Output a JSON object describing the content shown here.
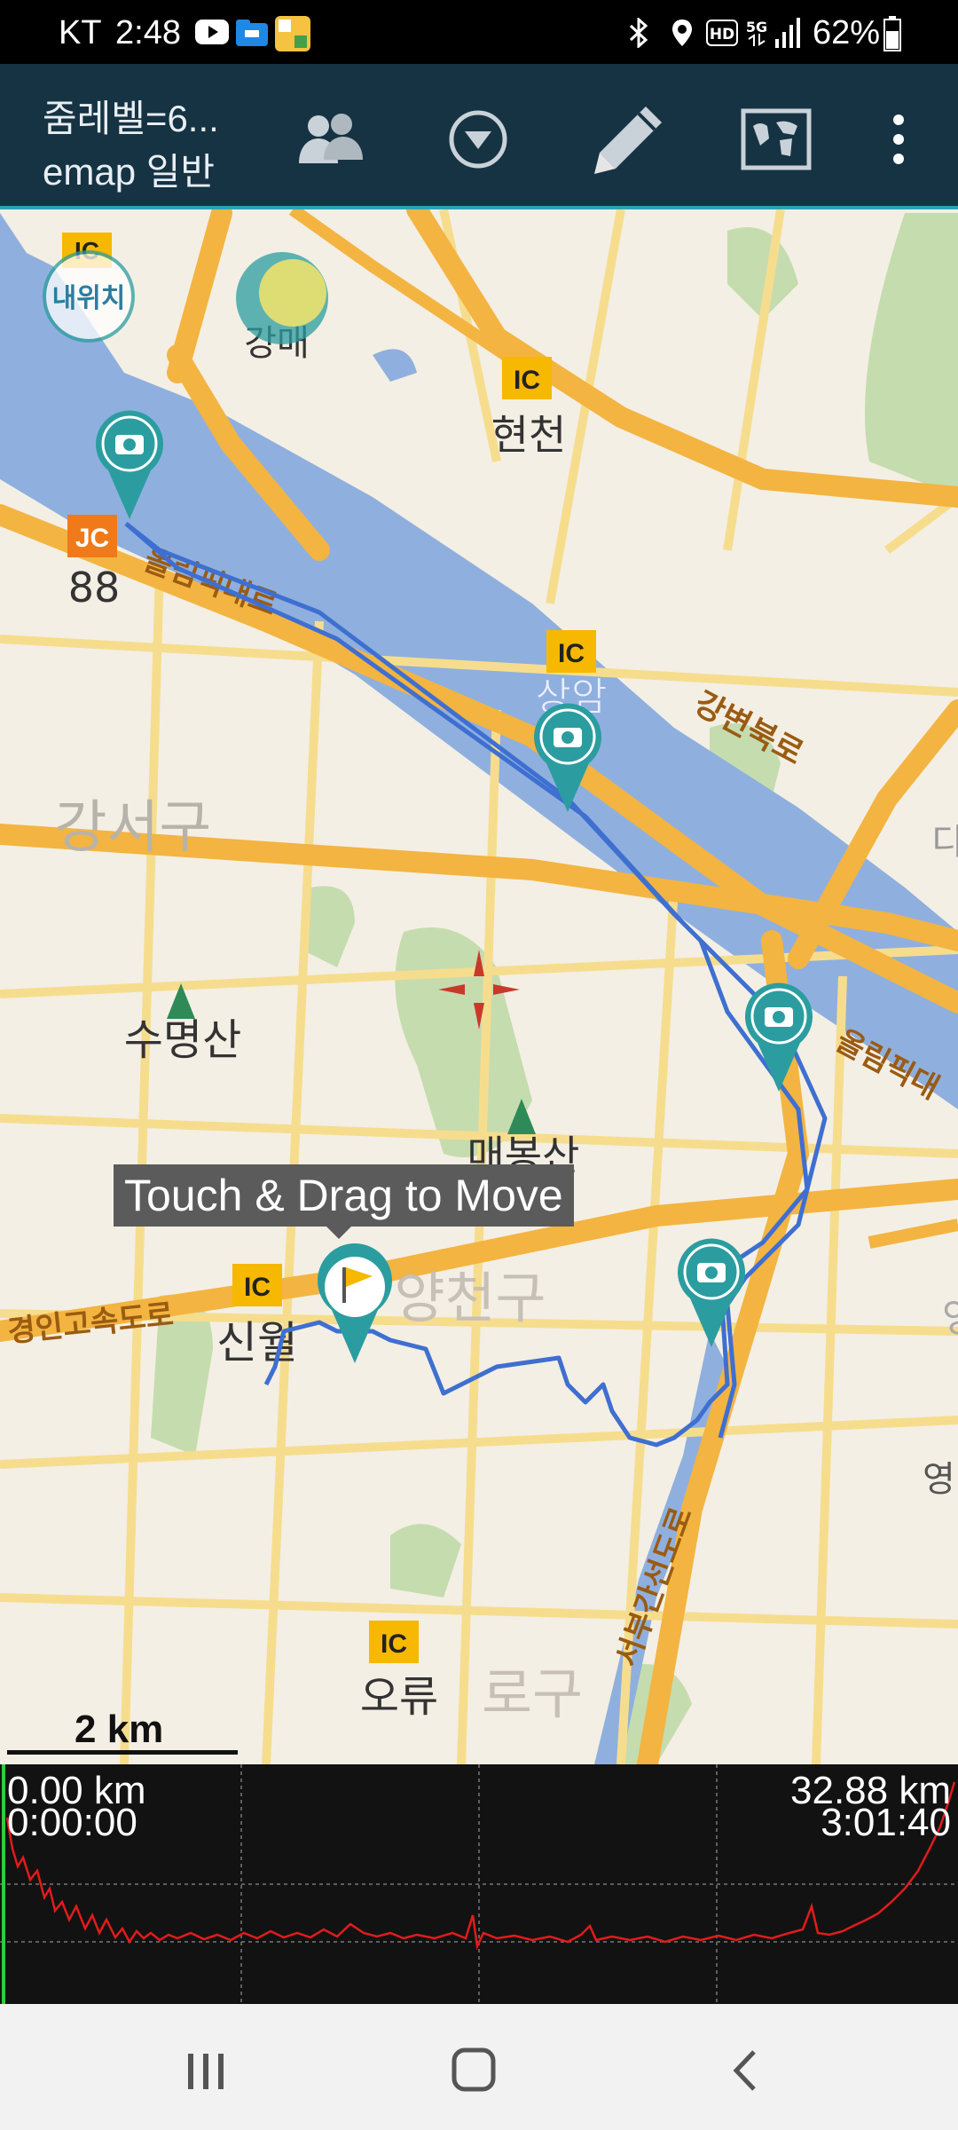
{
  "status_bar": {
    "carrier": "KT",
    "time": "2:48",
    "battery": "62%",
    "icons": [
      "youtube-icon",
      "folder-icon",
      "gallery-icon",
      "bluetooth-icon",
      "location-icon",
      "hd-icon",
      "5g-icon",
      "signal-icon",
      "battery-icon"
    ]
  },
  "app_bar": {
    "title_line1": "줌레벨=6...",
    "title_line2": "emap 일반",
    "actions": [
      "group-icon",
      "dropdown-icon",
      "pencil-icon",
      "world-map-icon",
      "more-icon"
    ]
  },
  "map": {
    "my_location_label": "내위치",
    "tooltip": "Touch & Drag to Move",
    "labels": {
      "ic_badge": "IC",
      "jc_badge": "JC",
      "jc_number": "88",
      "hyeoncheon": "현천",
      "sangam": "상암",
      "gangseo": "강서구",
      "sumyeongsan": "수명산",
      "maebongsan": "매봉산",
      "sinwol": "신월",
      "yangcheon": "양천구",
      "oryu": "오류",
      "guro": "로구",
      "gangbyeon": "강변북로",
      "olympic_left": "올림픽대로",
      "olympic_right": "올림픽대",
      "gyeongin": "경인고속도로",
      "seobu": "서부간선도로",
      "gangmae": "강매",
      "yeong1": "영",
      "yeong2": "영",
      "di": "디"
    },
    "colors": {
      "land": "#f4efe4",
      "river": "#8fb0de",
      "highway": "#f3b441",
      "road": "#f6dd8e",
      "park": "#c5dcaf",
      "track": "#3e6fd1",
      "marker": "#2b9da0"
    }
  },
  "scale_bar": {
    "label": "2 km"
  },
  "elevation_panel": {
    "start_distance": "0.00 km",
    "start_time": "0:00:00",
    "end_distance": "32.88 km",
    "end_time": "3:01:40"
  },
  "nav_bar": {
    "buttons": [
      "recent-apps-icon",
      "home-icon",
      "back-icon"
    ]
  }
}
